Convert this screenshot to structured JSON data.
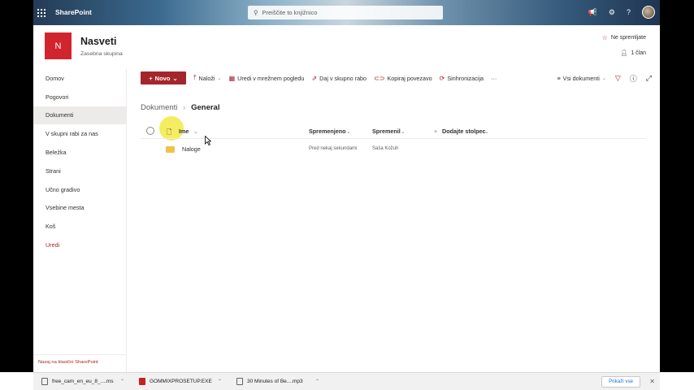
{
  "suite": {
    "brand": "SharePoint",
    "search_placeholder": "Preiščite to knjižnico"
  },
  "site": {
    "logo_letter": "N",
    "title": "Nasveti",
    "subtitle": "Zasebna skupina",
    "follow": "Ne spremljate",
    "members": "1 član"
  },
  "nav": {
    "items": [
      "Domov",
      "Pogovori",
      "Dokumenti",
      "V skupni rabi za nas",
      "Beležka",
      "Strani",
      "Učno gradivo",
      "Vsebine mesta",
      "Koš"
    ],
    "edit": "Uredi",
    "back": "Nazaj na klasični SharePoint"
  },
  "commands": {
    "new": "Novo",
    "upload": "Naloži",
    "grid": "Uredi v mrežnem pogledu",
    "share": "Daj v skupno rabo",
    "copy_link": "Kopiraj povezavo",
    "sync": "Sinhronizacija",
    "more": "···",
    "view": "Vsi dokumenti"
  },
  "breadcrumb": {
    "parent": "Dokumenti",
    "current": "General"
  },
  "columns": {
    "name": "Ime",
    "modified": "Spremenjeno",
    "modified_by": "Spremenil",
    "add_column": "Dodajte stolpec"
  },
  "rows": [
    {
      "name": "Naloge",
      "modified": "Pred nekaj sekundami",
      "modified_by": "Saša Kožuh"
    }
  ],
  "downloads": {
    "items": [
      "free_cam_en_eu_8_....ms",
      "GOMMIXPROSETUP.EXE",
      "30 Minutes of Be....mp3"
    ],
    "show_all": "Prikaži vse"
  },
  "colors": {
    "accent": "#a4262c",
    "logo": "#d1252e",
    "folder": "#f0c24d"
  }
}
